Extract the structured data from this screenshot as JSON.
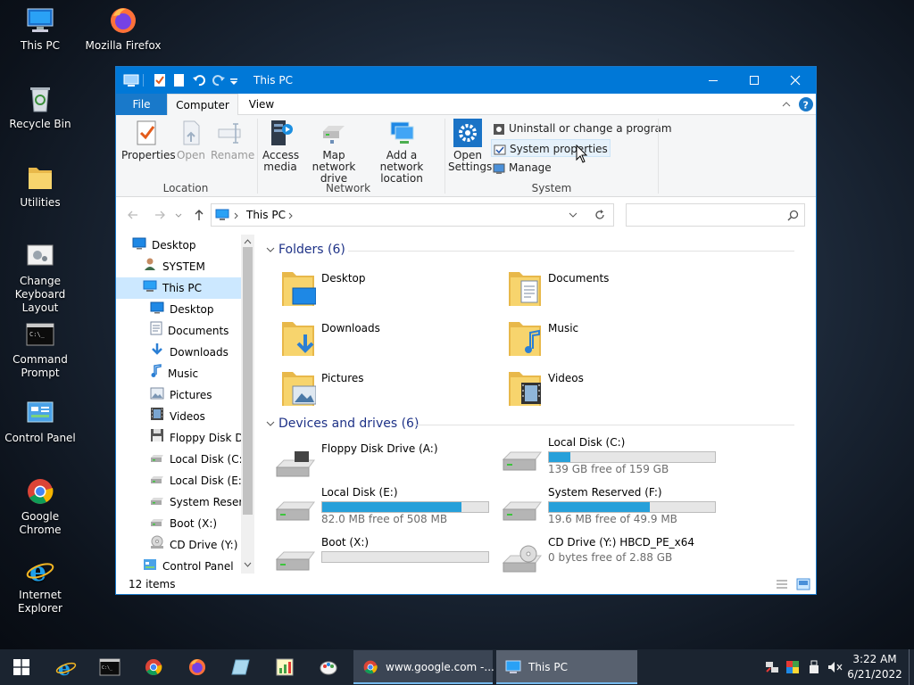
{
  "desktop": {
    "icons": [
      {
        "label": "This PC",
        "icon": "computer-icon"
      },
      {
        "label": "Mozilla Firefox",
        "icon": "firefox-icon"
      },
      {
        "label": "Recycle Bin",
        "icon": "recycle-bin-icon"
      },
      {
        "label": "Utilities",
        "icon": "folder-icon"
      },
      {
        "label": "Change Keyboard Layout",
        "icon": "keyboard-settings-icon"
      },
      {
        "label": "Command Prompt",
        "icon": "command-prompt-icon"
      },
      {
        "label": "Control Panel",
        "icon": "control-panel-icon"
      },
      {
        "label": "Google Chrome",
        "icon": "chrome-icon"
      },
      {
        "label": "Internet Explorer",
        "icon": "internet-explorer-icon"
      }
    ]
  },
  "window": {
    "title": "This PC",
    "tabs": {
      "file": "File",
      "computer": "Computer",
      "view": "View"
    },
    "ribbon": {
      "location": {
        "group_label": "Location",
        "properties": "Properties",
        "open": "Open",
        "rename": "Rename"
      },
      "network": {
        "group_label": "Network",
        "access_media": "Access media",
        "map_network_drive": "Map network drive",
        "add_network_location": "Add a network location"
      },
      "system": {
        "group_label": "System",
        "open_settings": "Open Settings",
        "uninstall": "Uninstall or change a program",
        "system_properties": "System properties",
        "manage": "Manage"
      }
    },
    "address": {
      "path": "This PC",
      "search_placeholder": ""
    },
    "nav_tree": [
      {
        "label": "Desktop",
        "icon": "desktop-icon",
        "indent": 0
      },
      {
        "label": "SYSTEM",
        "icon": "user-icon",
        "indent": 1
      },
      {
        "label": "This PC",
        "icon": "computer-icon",
        "indent": 1,
        "selected": true
      },
      {
        "label": "Desktop",
        "icon": "desktop-icon",
        "indent": 2
      },
      {
        "label": "Documents",
        "icon": "documents-icon",
        "indent": 2
      },
      {
        "label": "Downloads",
        "icon": "downloads-icon",
        "indent": 2
      },
      {
        "label": "Music",
        "icon": "music-icon",
        "indent": 2
      },
      {
        "label": "Pictures",
        "icon": "pictures-icon",
        "indent": 2
      },
      {
        "label": "Videos",
        "icon": "videos-icon",
        "indent": 2
      },
      {
        "label": "Floppy Disk Dri",
        "icon": "floppy-icon",
        "indent": 2
      },
      {
        "label": "Local Disk (C:)",
        "icon": "drive-icon",
        "indent": 2
      },
      {
        "label": "Local Disk (E:)",
        "icon": "drive-icon",
        "indent": 2
      },
      {
        "label": "System Reserve",
        "icon": "drive-icon",
        "indent": 2
      },
      {
        "label": "Boot (X:)",
        "icon": "drive-icon",
        "indent": 2
      },
      {
        "label": "CD Drive (Y:) H",
        "icon": "cd-drive-icon",
        "indent": 2
      },
      {
        "label": "Control Panel",
        "icon": "control-panel-icon",
        "indent": 1
      }
    ],
    "folders_header": "Folders (6)",
    "folders": [
      {
        "label": "Desktop",
        "icon": "desktop-folder-icon"
      },
      {
        "label": "Documents",
        "icon": "documents-folder-icon"
      },
      {
        "label": "Downloads",
        "icon": "downloads-folder-icon"
      },
      {
        "label": "Music",
        "icon": "music-folder-icon"
      },
      {
        "label": "Pictures",
        "icon": "pictures-folder-icon"
      },
      {
        "label": "Videos",
        "icon": "videos-folder-icon"
      }
    ],
    "drives_header": "Devices and drives (6)",
    "drives": [
      {
        "label": "Floppy Disk Drive (A:)",
        "icon": "floppy-drive-icon",
        "free": "",
        "used_fraction": null
      },
      {
        "label": "Local Disk (C:)",
        "icon": "hard-drive-icon",
        "free": "139 GB free of 159 GB",
        "used_fraction": 0.13
      },
      {
        "label": "Local Disk (E:)",
        "icon": "hard-drive-icon",
        "free": "82.0 MB free of 508 MB",
        "used_fraction": 0.84
      },
      {
        "label": "System Reserved (F:)",
        "icon": "hard-drive-icon",
        "free": "19.6 MB free of 49.9 MB",
        "used_fraction": 0.61
      },
      {
        "label": "Boot (X:)",
        "icon": "hard-drive-icon",
        "free": "",
        "used_fraction": 0.0
      },
      {
        "label": "CD Drive (Y:) HBCD_PE_x64",
        "icon": "cd-drive-icon",
        "free": "0 bytes free of 2.88 GB",
        "used_fraction": null
      }
    ],
    "status": "12 items"
  },
  "taskbar": {
    "pinned": [
      "start-icon",
      "internet-explorer-icon",
      "command-prompt-icon",
      "chrome-icon",
      "firefox-icon",
      "notepad-icon",
      "chart-app-icon",
      "paint-icon"
    ],
    "tasks": [
      {
        "label": "www.google.com -...",
        "icon": "chrome-icon"
      },
      {
        "label": "This PC",
        "icon": "computer-icon"
      }
    ],
    "time": "3:22 AM",
    "date": "6/21/2022"
  },
  "colors": {
    "accent": "#0078d7",
    "selection": "#cce8ff",
    "drive_bar": "#26a0da",
    "header_text": "#1e3287"
  }
}
